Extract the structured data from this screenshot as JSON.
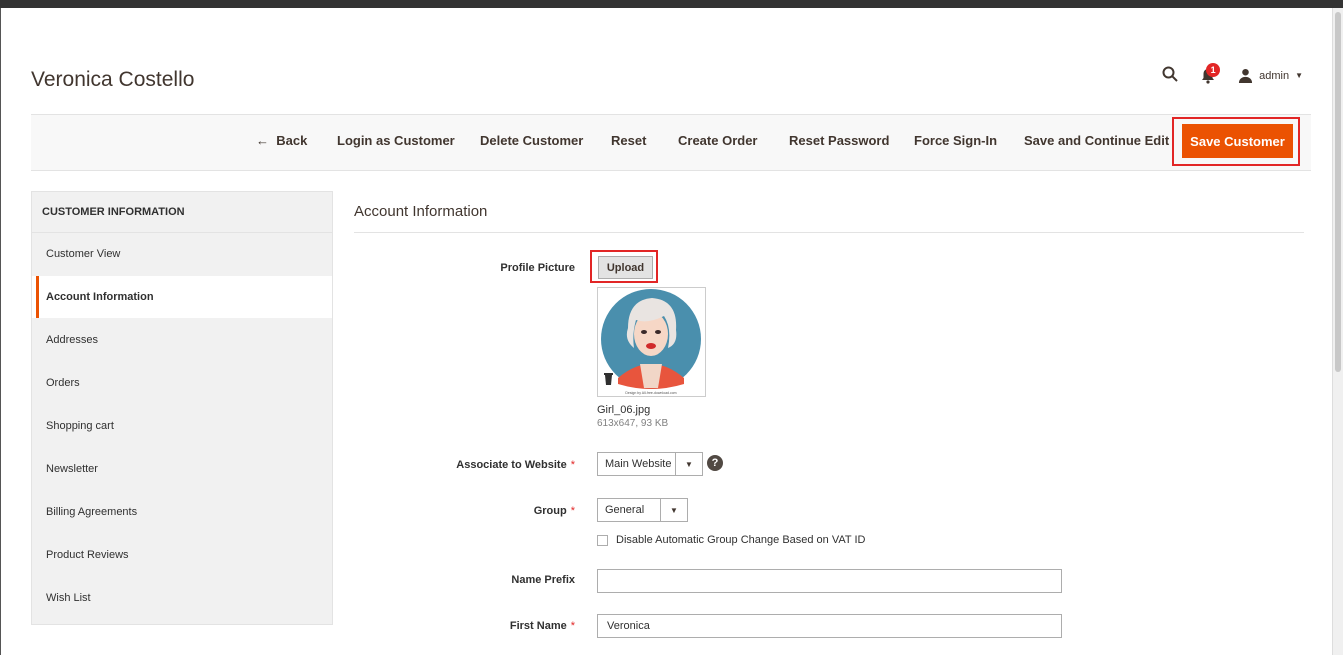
{
  "page": {
    "title": "Veronica Costello"
  },
  "header": {
    "notifications_count": "1",
    "user_label": "admin"
  },
  "actions": {
    "back": "Back",
    "login_as_customer": "Login as Customer",
    "delete_customer": "Delete Customer",
    "reset": "Reset",
    "create_order": "Create Order",
    "reset_password": "Reset Password",
    "force_sign_in": "Force Sign-In",
    "save_continue": "Save and Continue Edit",
    "save_customer": "Save Customer"
  },
  "sidebar": {
    "heading": "CUSTOMER INFORMATION",
    "items": [
      {
        "label": "Customer View"
      },
      {
        "label": "Account Information"
      },
      {
        "label": "Addresses"
      },
      {
        "label": "Orders"
      },
      {
        "label": "Shopping cart"
      },
      {
        "label": "Newsletter"
      },
      {
        "label": "Billing Agreements"
      },
      {
        "label": "Product Reviews"
      },
      {
        "label": "Wish List"
      }
    ]
  },
  "form": {
    "section_title": "Account Information",
    "profile_picture": {
      "label": "Profile Picture",
      "upload_label": "Upload",
      "file_name": "Girl_06.jpg",
      "file_meta": "613x647, 93 KB",
      "watermark": "Design by All-free-download.com"
    },
    "website": {
      "label": "Associate to Website",
      "value": "Main Website"
    },
    "group": {
      "label": "Group",
      "value": "General"
    },
    "vat_checkbox_label": "Disable Automatic Group Change Based on VAT ID",
    "name_prefix": {
      "label": "Name Prefix",
      "value": ""
    },
    "first_name": {
      "label": "First Name",
      "value": "Veronica"
    }
  },
  "colors": {
    "accent": "#eb5202",
    "highlight_border": "#e22626",
    "sidebar_bg": "#f1f1f1"
  }
}
